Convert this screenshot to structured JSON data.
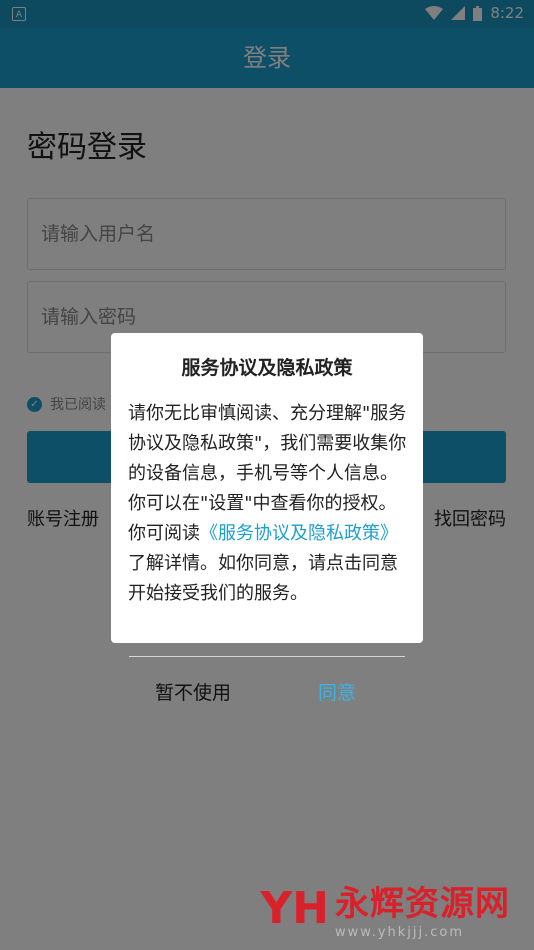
{
  "status_bar": {
    "time": "8:22",
    "left_icon": "A"
  },
  "app_bar": {
    "title": "登录"
  },
  "login": {
    "heading": "密码登录",
    "username_placeholder": "请输入用户名",
    "password_placeholder": "请输入密码",
    "agree_text": "我已阅读",
    "register_link": "账号注册",
    "forgot_link": "找回密码"
  },
  "dialog": {
    "title": "服务协议及隐私政策",
    "body_before": "请你无比审慎阅读、充分理解\"服务协议及隐私政策\"，我们需要收集你的设备信息，手机号等个人信息。你可以在\"设置\"中查看你的授权。你可阅读",
    "body_link": "《服务协议及隐私政策》",
    "body_after": "了解详情。如你同意，请点击同意开始接受我们的服务。",
    "decline_label": "暂不使用",
    "accept_label": "同意"
  },
  "watermark": {
    "logo": "YH",
    "name": "永辉资源网",
    "url": "www.yhkjjj.com"
  },
  "colors": {
    "primary": "#1d9fd0",
    "status_bar": "#1a95bf",
    "accept": "#3ab4e3",
    "watermark": "#d9212b"
  }
}
